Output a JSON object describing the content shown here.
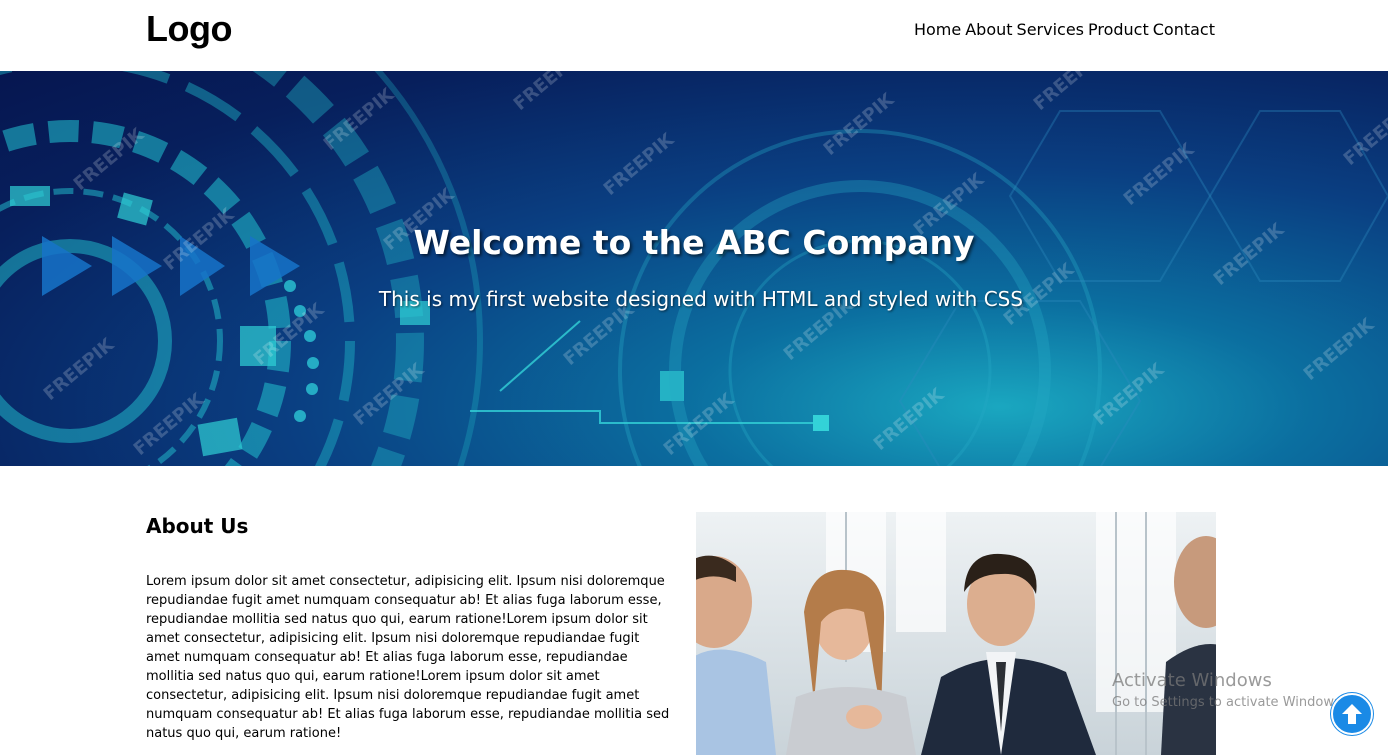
{
  "header": {
    "logo": "Logo",
    "nav": [
      "Home",
      "About",
      "Services",
      "Product",
      "Contact"
    ]
  },
  "hero": {
    "title": "Welcome to the ABC Company",
    "subtitle": "This is my first website designed with HTML and styled with CSS",
    "watermark": "FREEPIK"
  },
  "about": {
    "title": "About Us",
    "text": "Lorem ipsum dolor sit amet consectetur, adipisicing elit. Ipsum nisi doloremque repudiandae fugit amet numquam consequatur ab! Et alias fuga laborum esse, repudiandae mollitia sed natus quo qui, earum ratione!Lorem ipsum dolor sit amet consectetur, adipisicing elit. Ipsum nisi doloremque repudiandae fugit amet numquam consequatur ab! Et alias fuga laborum esse, repudiandae mollitia sed natus quo qui, earum ratione!Lorem ipsum dolor sit amet consectetur, adipisicing elit. Ipsum nisi doloremque repudiandae fugit amet numquam consequatur ab! Et alias fuga laborum esse, repudiandae mollitia sed natus quo qui, earum ratione!"
  },
  "watermark_os": {
    "line1": "Activate Windows",
    "line2": "Go to Settings to activate Windows."
  },
  "icons": {
    "scroll_top": "arrow-up-icon"
  },
  "colors": {
    "hero_dark": "#071f5c",
    "hero_accent": "#1aa7c0",
    "scroll_button": "#1a8ae6"
  }
}
